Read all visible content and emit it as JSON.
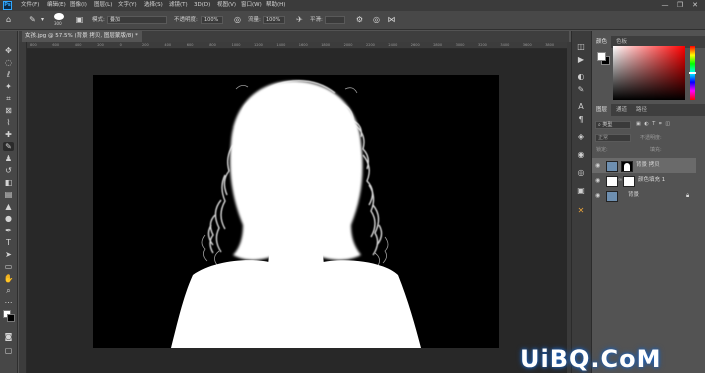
{
  "menubar": {
    "logo": "Ps",
    "items": [
      "文件(F)",
      "编辑(E)",
      "图像(I)",
      "图层(L)",
      "文字(Y)",
      "选择(S)",
      "滤镜(T)",
      "3D(D)",
      "视图(V)",
      "窗口(W)",
      "帮助(H)"
    ],
    "window_controls": {
      "minimize": "—",
      "restore": "❐",
      "close": "✕"
    }
  },
  "options": {
    "brush_size": "300",
    "mode_label": "模式:",
    "mode_value": "叠加",
    "opacity_label": "不透明度:",
    "opacity_value": "100%",
    "flow_label": "流量:",
    "flow_value": "100%",
    "smoothing_label": "平滑:"
  },
  "document": {
    "tab_title": "女孩.jpg @ 57.5% (背景 拷贝, 图层蒙版/8) *",
    "tab_close": "×",
    "ruler_ticks": [
      "800",
      "600",
      "400",
      "200",
      "0",
      "200",
      "400",
      "600",
      "800",
      "1000",
      "1200",
      "1400",
      "1600",
      "1800",
      "2000",
      "2200",
      "2400",
      "2600",
      "2800",
      "3000",
      "3200",
      "3400",
      "3600",
      "3800"
    ]
  },
  "color_panel": {
    "tabs": [
      "颜色",
      "色板"
    ],
    "hue_color": "#ff0000"
  },
  "layers_panel": {
    "tabs": [
      "图层",
      "通道",
      "路径"
    ],
    "filter_label": "类型",
    "blend_mode": "正常",
    "opacity_label": "不透明度:",
    "fill_label": "填充:",
    "lock_label": "锁定:",
    "layers": [
      {
        "name": "背景 拷贝",
        "selected": true
      },
      {
        "name": "颜色填充 1",
        "selected": false
      },
      {
        "name": "背景",
        "selected": false
      }
    ]
  },
  "watermark": {
    "text": "UiBQ.CoM"
  }
}
